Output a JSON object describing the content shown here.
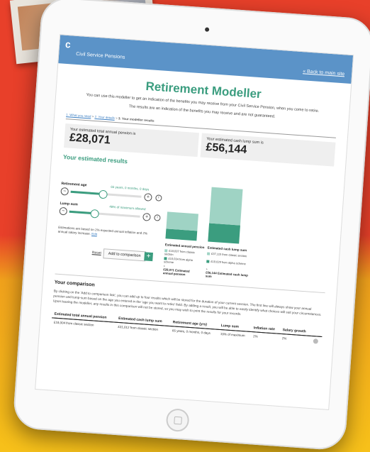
{
  "header": {
    "logo_mark": "ᶜ",
    "logo_text": "Civil Service Pensions",
    "back_link": "« Back to main site"
  },
  "page": {
    "title": "Retirement Modeller",
    "intro": "You can use this modeller to get an indication of the benefits you may receive from your Civil Service Pension, when you come to retire.",
    "intro2": "The results are an indication of the benefits you may receive and are not guaranteed."
  },
  "breadcrumb": {
    "step1": "1. What you need",
    "sep": " > ",
    "step2": "2. Your details",
    "step3": "3. Your modeller results"
  },
  "totals": {
    "pension_label": "Your estimated total annual pension is",
    "pension_value": "£28,071",
    "lump_label": "Your estimated cash lump sum is",
    "lump_value": "£56,144"
  },
  "results": {
    "heading": "Your estimated results",
    "retirement_label": "Retirement age",
    "retirement_value": "65 years, 0 months, 0 days",
    "retirement_level": 0.45,
    "lump_label": "Lump sum",
    "lump_value": "48% of maximum allowed",
    "lump_level": 0.35,
    "note": "Estimations are based on 2% expected annual inflation and 2% annual salary increase.",
    "note_link": "Edit",
    "reset": "Reset",
    "add_comparison": "Add to comparison",
    "plus": "+",
    "minus": "−",
    "info": "i"
  },
  "chart_data": {
    "type": "bar",
    "categories": [
      "Estimated annual pension",
      "Estimated cash lump sum"
    ],
    "series": [
      {
        "name": "from classic section",
        "values": [
          18037,
          37115
        ]
      },
      {
        "name": "from alpha scheme",
        "values": [
          10034,
          19029
        ]
      }
    ],
    "colors": {
      "classic": "#9fd3c4",
      "alpha": "#3b9d7f"
    }
  },
  "legend": {
    "pension_classic": "£18,037 from classic section",
    "pension_alpha": "£10,034 from alpha scheme",
    "pension_plus": "+",
    "pension_total": "£28,071 Estimated annual pension",
    "lump_classic": "£37,115 from classic section",
    "lump_alpha": "£19,029 from alpha scheme",
    "lump_plus": "+",
    "lump_total": "£56,144 Estimated cash lump sum"
  },
  "comparison": {
    "heading": "Your comparison",
    "text": "By clicking on the 'Add to comparison link', you can add up to four results which will be stored for the duration of your current session. The first line will always show your annual pension and lump-sum based on the age you entered in the 'age you want to retire' field. By adding a result, you will be able to easily identify what choices will suit your circumstances. Upon leaving the modeller, any results in this comparison will not be stored, so you may wish to print the results for your records.",
    "columns": [
      "Estimated total annual pension",
      "Estimated cash lump sum",
      "Retirement age (yrs)",
      "Lump sum",
      "Inflation rate",
      "Salary growth"
    ],
    "rows": [
      [
        "£18,004 from classic section",
        "£31,012 from classic section",
        "65 years, 0 months, 0 days",
        "19% of maximum",
        "2%",
        "2%"
      ]
    ]
  }
}
